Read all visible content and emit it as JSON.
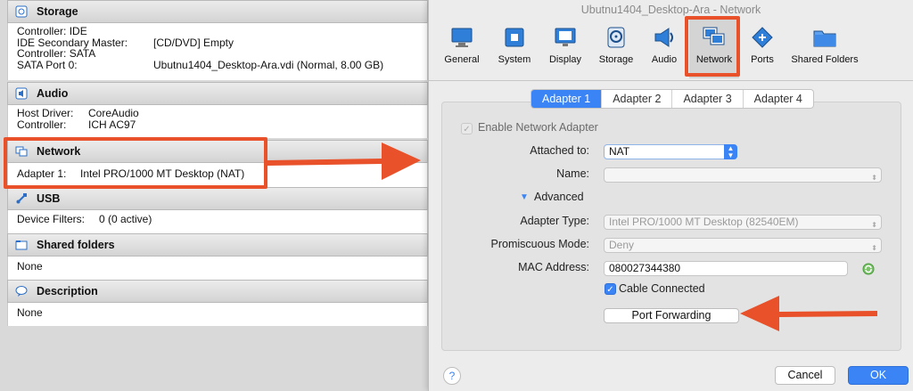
{
  "details": {
    "storage": {
      "title": "Storage",
      "rows": [
        {
          "label": "Controller: IDE",
          "value": ""
        },
        {
          "label": " IDE Secondary Master:",
          "value": "[CD/DVD] Empty"
        },
        {
          "label": "Controller: SATA",
          "value": ""
        },
        {
          "label": " SATA Port 0:",
          "value": "Ubutnu1404_Desktop-Ara.vdi (Normal, 8.00 GB)"
        }
      ]
    },
    "audio": {
      "title": "Audio",
      "rows": [
        {
          "label": "Host Driver:",
          "value": "CoreAudio"
        },
        {
          "label": "Controller:",
          "value": "ICH AC97"
        }
      ]
    },
    "network": {
      "title": "Network",
      "rows": [
        {
          "label": "Adapter 1:",
          "value": "Intel PRO/1000 MT Desktop (NAT)"
        }
      ]
    },
    "usb": {
      "title": "USB",
      "rows": [
        {
          "label": "Device Filters:",
          "value": "0 (0 active)"
        }
      ]
    },
    "shared": {
      "title": "Shared folders",
      "rows": [
        {
          "label": "None",
          "value": ""
        }
      ]
    },
    "description": {
      "title": "Description",
      "rows": [
        {
          "label": "None",
          "value": ""
        }
      ]
    }
  },
  "dialog": {
    "title": "Ubutnu1404_Desktop-Ara - Network",
    "toolbar": [
      {
        "label": "General",
        "icon": "monitor-icon"
      },
      {
        "label": "System",
        "icon": "chip-icon"
      },
      {
        "label": "Display",
        "icon": "display-icon"
      },
      {
        "label": "Storage",
        "icon": "disk-icon"
      },
      {
        "label": "Audio",
        "icon": "speaker-icon"
      },
      {
        "label": "Network",
        "icon": "network-icon",
        "selected": true
      },
      {
        "label": "Ports",
        "icon": "ports-icon"
      },
      {
        "label": "Shared Folders",
        "icon": "folder-icon"
      }
    ],
    "tabs": [
      "Adapter 1",
      "Adapter 2",
      "Adapter 3",
      "Adapter 4"
    ],
    "active_tab": 0,
    "enable_adapter": {
      "label": "Enable Network Adapter",
      "checked": true,
      "disabled": true
    },
    "attached_to": {
      "label": "Attached to:",
      "value": "NAT"
    },
    "name": {
      "label": "Name:",
      "value": ""
    },
    "advanced": {
      "label": "Advanced"
    },
    "adapter_type": {
      "label": "Adapter Type:",
      "value": "Intel PRO/1000 MT Desktop (82540EM)"
    },
    "promiscuous": {
      "label": "Promiscuous Mode:",
      "value": "Deny"
    },
    "mac": {
      "label": "MAC Address:",
      "value": "080027344380"
    },
    "cable": {
      "label": "Cable Connected",
      "checked": true
    },
    "port_forwarding": "Port Forwarding",
    "help": "?",
    "cancel": "Cancel",
    "ok": "OK"
  },
  "colors": {
    "accent": "#3a84f5",
    "annotation": "#e8512a"
  }
}
